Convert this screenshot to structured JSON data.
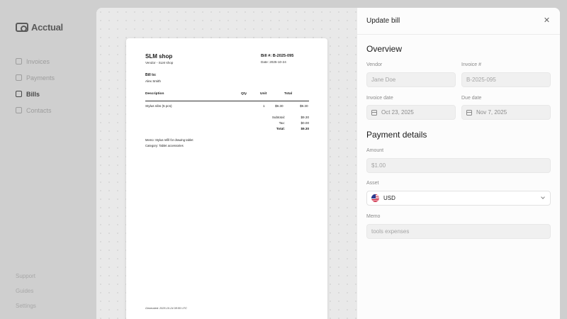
{
  "app": {
    "logo": "Acctual",
    "nav": [
      {
        "label": "Invoices",
        "icon": "invoice-icon",
        "active": false
      },
      {
        "label": "Payments",
        "icon": "payment-icon",
        "active": false
      },
      {
        "label": "Bills",
        "icon": "bill-icon",
        "active": true
      },
      {
        "label": "Contacts",
        "icon": "contacts-icon",
        "active": false
      }
    ],
    "nav_bottom": [
      {
        "label": "Support"
      },
      {
        "label": "Guides"
      },
      {
        "label": "Settings"
      }
    ]
  },
  "preview": {
    "shop": "SLM shop",
    "vendor_line": "Vendor - SLM shop",
    "bill_number": "Bill #: B-2025-095",
    "date": "Date: 2025-10-24",
    "bill_to_label": "Bill to:",
    "bill_to_name": "Alex Smith",
    "headers": {
      "description": "Description",
      "qty": "Qty",
      "unit": "Unit",
      "total": "Total"
    },
    "line": {
      "description": "Stylus nibs (5 pcs)",
      "qty": "1",
      "unit": "$9.30",
      "total": "$9.30"
    },
    "subtotal_label": "Subtotal:",
    "subtotal": "$9.30",
    "tax_label": "Tax:",
    "tax": "$0.00",
    "total_label": "Total:",
    "total": "$9.30",
    "memo": "Memo: Stylus refill for drawing tablet",
    "category": "Category: Tablet accessories",
    "generated": "Generated: 2025-10-24 08:55 UTC"
  },
  "form": {
    "title": "Update bill",
    "overview_title": "Overview",
    "vendor_label": "Vendor",
    "vendor_placeholder": "Jane Doe",
    "invoice_label": "Invoice #",
    "invoice_placeholder": "B-2025-095",
    "invoice_date_label": "Invoice date",
    "invoice_date": "Oct 23, 2025",
    "due_date_label": "Due date",
    "due_date": "Nov 7, 2025",
    "payment_title": "Payment details",
    "amount_label": "Amount",
    "amount_placeholder": "$1.00",
    "asset_label": "Asset",
    "asset": "USD",
    "memo_label": "Memo",
    "memo_placeholder": "tools expenses"
  }
}
